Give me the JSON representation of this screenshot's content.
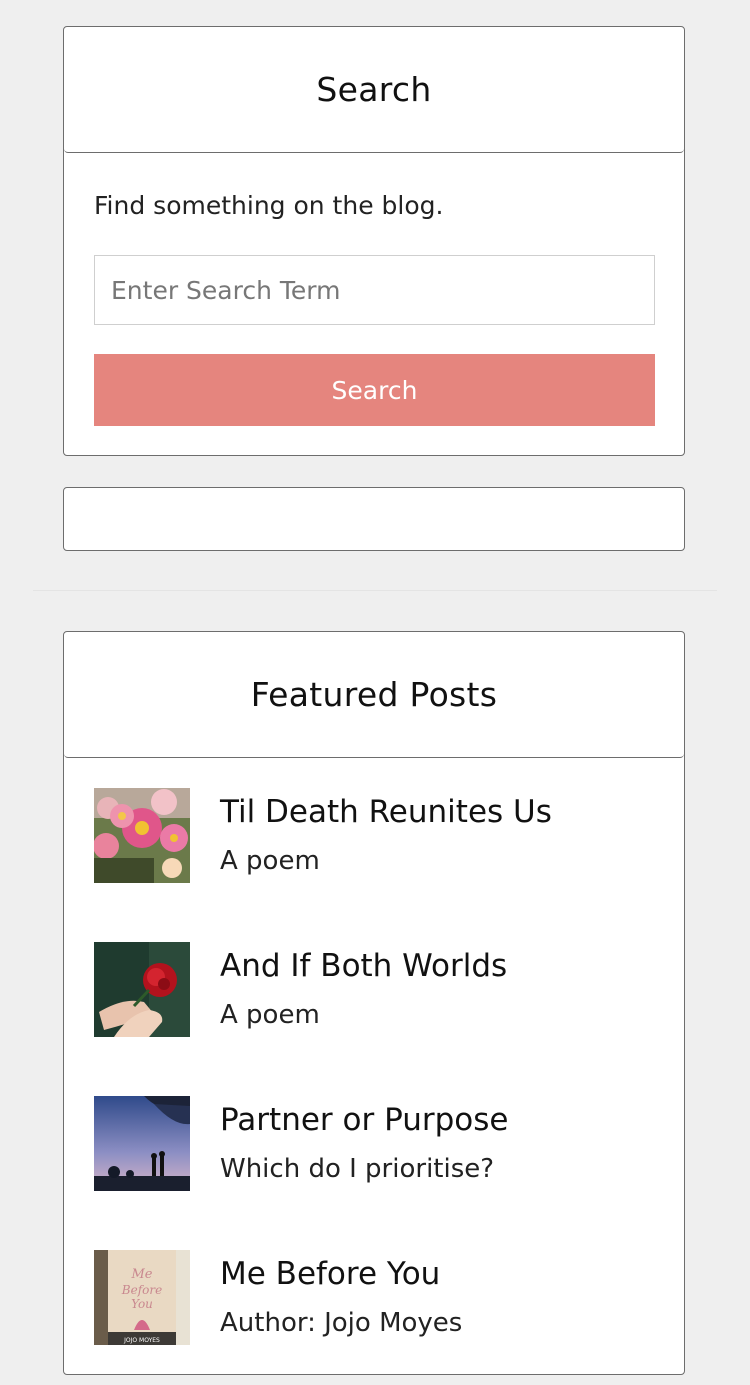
{
  "search_widget": {
    "title": "Search",
    "description": "Find something on the blog.",
    "input_placeholder": "Enter Search Term",
    "input_value": "",
    "button_label": "Search",
    "button_color": "#e5857e"
  },
  "featured_widget": {
    "title": "Featured Posts",
    "posts": [
      {
        "title": "Til Death Reunites Us",
        "subtitle": "A poem",
        "thumb_icon": "pink-flowers-thumbnail"
      },
      {
        "title": "And If Both Worlds",
        "subtitle": "A poem",
        "thumb_icon": "red-rose-hands-thumbnail"
      },
      {
        "title": "Partner or Purpose",
        "subtitle": "Which do I prioritise?",
        "thumb_icon": "sunset-silhouette-thumbnail"
      },
      {
        "title": "Me Before You",
        "subtitle": "Author: Jojo Moyes",
        "thumb_icon": "book-cover-thumbnail"
      }
    ]
  },
  "book_cover_text": {
    "line1": "Me",
    "line2": "Before",
    "line3": "You",
    "author": "JOJO MOYES"
  }
}
